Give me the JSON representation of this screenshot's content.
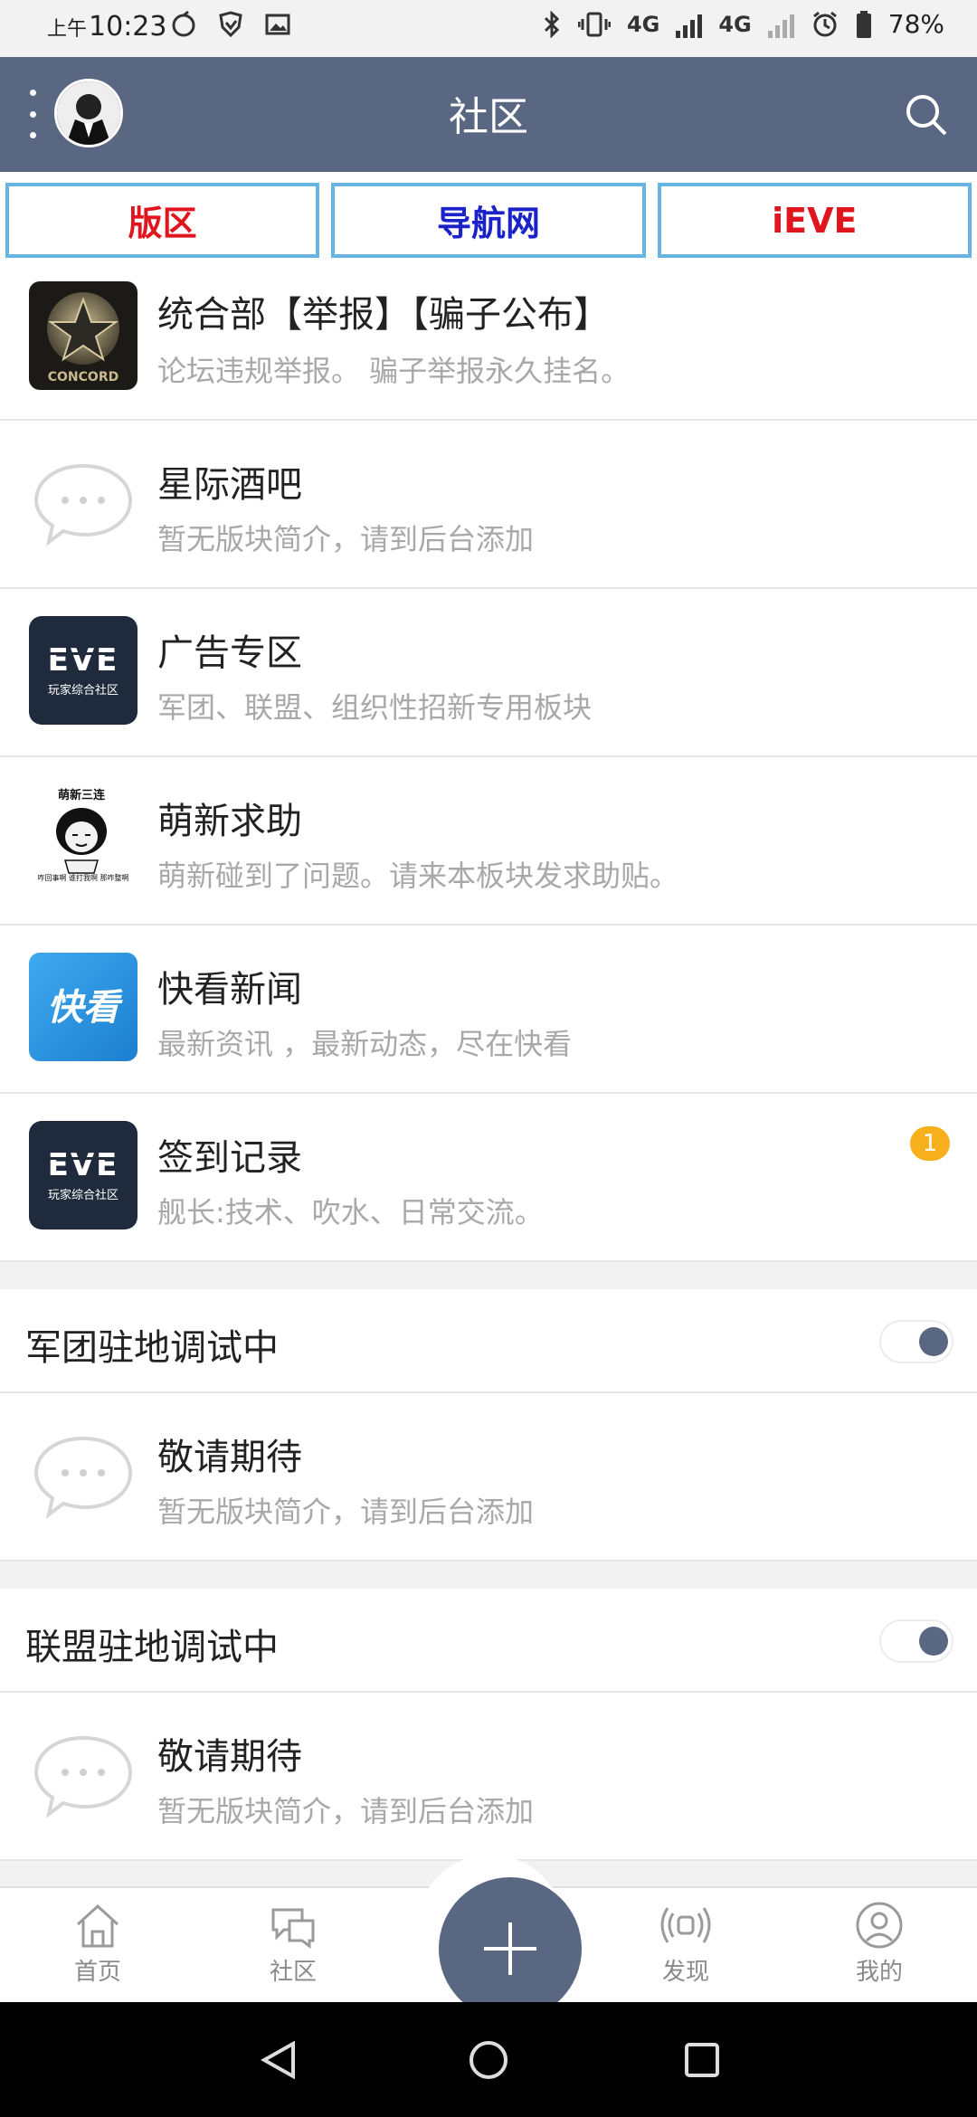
{
  "status_bar": {
    "time_prefix": "上午",
    "time": "10:23",
    "net1": "4G",
    "net2": "4G",
    "sim1": "1",
    "sim2": "2",
    "battery": "78%"
  },
  "header": {
    "title": "社区"
  },
  "links": [
    {
      "label": "版区",
      "color": "#e0161e"
    },
    {
      "label": "导航网",
      "color": "#1a22c8"
    },
    {
      "label": "iEVE",
      "color": "#e0161e"
    }
  ],
  "forums": [
    {
      "name": "统合部【举报】【骗子公布】",
      "desc": "论坛违规举报。 骗子举报永久挂名。",
      "icon": "concord-icon"
    },
    {
      "name": "星际酒吧",
      "desc": "暂无版块简介，请到后台添加",
      "icon": "chat-bubble-icon"
    },
    {
      "name": "广告专区",
      "desc": "军团、联盟、组织性招新专用板块",
      "icon": "eve-logo-icon",
      "icon_sub": "玩家综合社区"
    },
    {
      "name": "萌新求助",
      "desc": "萌新碰到了问题。请来本板块发求助贴。",
      "icon": "meme-icon",
      "icon_top": "萌新三连",
      "icon_bottom": "咋回事啊 谁打我啊 那咋整啊"
    },
    {
      "name": "快看新闻",
      "desc": "最新资讯 ，最新动态，尽在快看",
      "icon": "kuaikan-icon",
      "icon_text": "快看"
    },
    {
      "name": "签到记录",
      "desc": "舰长:技术、吹水、日常交流。",
      "icon": "eve-logo-icon",
      "icon_sub": "玩家综合社区",
      "badge": "1"
    }
  ],
  "groups": [
    {
      "name": "军团驻地调试中",
      "toggle_on": true,
      "forum": {
        "name": "敬请期待",
        "desc": "暂无版块简介，请到后台添加",
        "icon": "chat-bubble-icon"
      }
    },
    {
      "name": "联盟驻地调试中",
      "toggle_on": true,
      "forum": {
        "name": "敬请期待",
        "desc": "暂无版块简介，请到后台添加",
        "icon": "chat-bubble-icon"
      }
    }
  ],
  "tabs": [
    {
      "label": "首页",
      "icon": "home-icon"
    },
    {
      "label": "社区",
      "icon": "community-icon"
    },
    {
      "label": "发现",
      "icon": "discover-icon"
    },
    {
      "label": "我的",
      "icon": "profile-icon"
    }
  ],
  "colors": {
    "primary": "#5a6782",
    "link_border": "#67b3e2",
    "badge": "#f6b01c"
  }
}
